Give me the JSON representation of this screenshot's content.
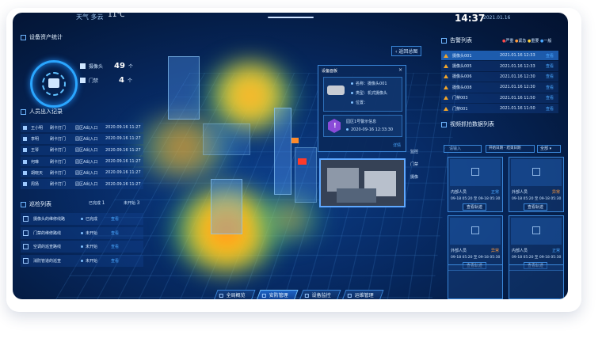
{
  "header": {
    "weather_label": "天气 多云",
    "temperature": "11℃",
    "time": "14:37",
    "date": "2021.01.16"
  },
  "colors": {
    "accent": "#2aa6ff",
    "alarm": "#f2a52a",
    "ok": "#4aa8ff",
    "warn": "#ff9a3c"
  },
  "assets": {
    "title": "设备资产统计",
    "camera_label": "摄像头",
    "camera_count": "49",
    "camera_unit": "个",
    "gate_label": "门禁",
    "gate_count": "4",
    "gate_unit": "个"
  },
  "access": {
    "title": "人员出入记录",
    "rows": [
      {
        "name": "王小明",
        "action": "刷卡打门",
        "place": "园区A出入口",
        "time": "2020.09.16 11:27"
      },
      {
        "name": "李明",
        "action": "刷卡打门",
        "place": "园区A出入口",
        "time": "2020.09.16 11:27"
      },
      {
        "name": "王琴",
        "action": "刷卡打门",
        "place": "园区A出入口",
        "time": "2020.09.16 11:27"
      },
      {
        "name": "何琳",
        "action": "刷卡打门",
        "place": "园区A出入口",
        "time": "2020.09.16 11:27"
      },
      {
        "name": "胡晓天",
        "action": "刷卡打门",
        "place": "园区A出入口",
        "time": "2020.09.16 11:27"
      },
      {
        "name": "周扬",
        "action": "刷卡打门",
        "place": "园区A出入口",
        "time": "2020.09.16 11:27"
      }
    ]
  },
  "inspection": {
    "title": "巡检列表",
    "done_label": "已完成",
    "done_count": "1",
    "todo_label": "未开始",
    "todo_count": "3",
    "rows": [
      {
        "name": "摄像头的维修线路",
        "status": "已完成",
        "link": "查看"
      },
      {
        "name": "门禁的维修路线",
        "status": "未开始",
        "link": "查看"
      },
      {
        "name": "空调的巡查路线",
        "status": "未开始",
        "link": "查看"
      },
      {
        "name": "消防管道的巡查",
        "status": "未开始",
        "link": "查看"
      }
    ]
  },
  "popup": {
    "title": "设备面板",
    "close": "×",
    "name_key": "名称",
    "name_val": "摄像头001",
    "type_key": "类型",
    "type_val": "机式摄像头",
    "loc_key": "位置",
    "loc_val": "",
    "alarm_text": "园区1号警示信息",
    "alarm_time": "2020-09-16 12:33:30",
    "detail": "详情"
  },
  "back_label": "返回总图",
  "side_tags": [
    "监控",
    "门禁",
    "摄像"
  ],
  "alarms": {
    "title": "告警列表",
    "legend": [
      "严重",
      "紧急",
      "重要",
      "一般"
    ],
    "rows": [
      {
        "name": "摄像头001",
        "time": "2021.01.16 12:33",
        "link": "查看"
      },
      {
        "name": "摄像头005",
        "time": "2021.01.16 12:33",
        "link": "查看"
      },
      {
        "name": "摄像头006",
        "time": "2021.01.16 12:30",
        "link": "查看"
      },
      {
        "name": "摄像头008",
        "time": "2021.01.16 12:30",
        "link": "查看"
      },
      {
        "name": "门禁003",
        "time": "2021.01.16 11:50",
        "link": "查看"
      },
      {
        "name": "门禁001",
        "time": "2021.01.16 11:50",
        "link": "查看"
      }
    ]
  },
  "video": {
    "title": "视频抓拍数据列表",
    "search_placeholder": "请输入",
    "date_range": "开始日期 - 结束日期",
    "filter": "全部",
    "cards": [
      {
        "label": "内部人员",
        "status": "正常",
        "time": "09-18 05:20 至 09-18 05:30",
        "btn": "查看轨迹"
      },
      {
        "label": "外部人员",
        "status": "异常",
        "time": "09-18 05:20 至 09-18 05:30",
        "btn": "查看轨迹"
      },
      {
        "label": "外部人员",
        "status": "异常",
        "time": "09-18 05:20 至 09-18 05:30",
        "btn": "查看轨迹"
      },
      {
        "label": "内部人员",
        "status": "正常",
        "time": "09-18 05:20 至 09-18 05:30",
        "btn": "查看轨迹"
      }
    ]
  },
  "nav": [
    "全局概览",
    "安防管理",
    "设备监控",
    "运维管理"
  ]
}
